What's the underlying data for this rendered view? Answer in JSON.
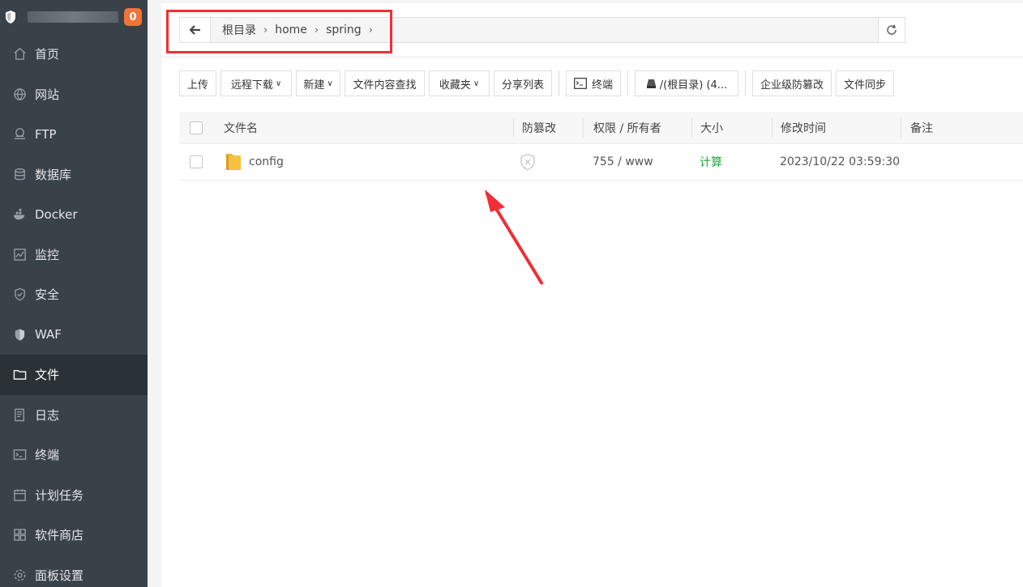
{
  "sidebar": {
    "badge": "0",
    "items": [
      {
        "label": "首页",
        "icon": "home-icon"
      },
      {
        "label": "网站",
        "icon": "globe-icon"
      },
      {
        "label": "FTP",
        "icon": "ftp-icon"
      },
      {
        "label": "数据库",
        "icon": "database-icon"
      },
      {
        "label": "Docker",
        "icon": "docker-icon"
      },
      {
        "label": "监控",
        "icon": "monitor-icon"
      },
      {
        "label": "安全",
        "icon": "shield-check-icon"
      },
      {
        "label": "WAF",
        "icon": "waf-shield-icon"
      },
      {
        "label": "文件",
        "icon": "folder-icon",
        "active": true
      },
      {
        "label": "日志",
        "icon": "log-icon"
      },
      {
        "label": "终端",
        "icon": "terminal-icon"
      },
      {
        "label": "计划任务",
        "icon": "calendar-icon"
      },
      {
        "label": "软件商店",
        "icon": "grid-icon"
      },
      {
        "label": "面板设置",
        "icon": "gear-icon"
      }
    ]
  },
  "path": {
    "crumbs": [
      "根目录",
      "home",
      "spring"
    ]
  },
  "toolbar": {
    "upload": "上传",
    "remote_download": "远程下载",
    "new": "新建",
    "content_search": "文件内容查找",
    "favorites": "收藏夹",
    "share_list": "分享列表",
    "terminal": "终端",
    "disk": "/(根目录) (4...",
    "tamper_proof": "企业级防篡改",
    "file_sync": "文件同步"
  },
  "table": {
    "headers": {
      "name": "文件名",
      "tamper": "防篡改",
      "perm": "权限 / 所有者",
      "size": "大小",
      "mtime": "修改时间",
      "note": "备注"
    },
    "rows": [
      {
        "name": "config",
        "perm": "755 / www",
        "size": "计算",
        "mtime": "2023/10/22 03:59:30",
        "note": ""
      }
    ]
  },
  "colors": {
    "sidebar_bg": "#394149",
    "sidebar_active": "#2b3237",
    "badge": "#f0733a",
    "highlight_red": "#ef2f36",
    "size_green": "#20a53a",
    "folder_yellow": "#f5c242"
  }
}
